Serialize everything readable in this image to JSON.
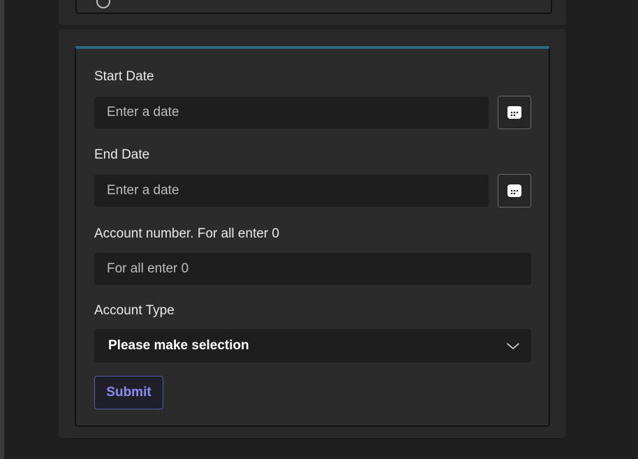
{
  "form": {
    "start_date": {
      "label": "Start Date",
      "placeholder": "Enter a date",
      "value": ""
    },
    "end_date": {
      "label": "End Date",
      "placeholder": "Enter a date",
      "value": ""
    },
    "account_number": {
      "label": "Account number. For all enter 0",
      "placeholder": "For all enter 0",
      "value": ""
    },
    "account_type": {
      "label": "Account Type",
      "selected": "Please make selection"
    },
    "submit_label": "Submit"
  },
  "icons": {
    "calendar": "calendar-icon",
    "chevron": "chevron-down-icon",
    "radio": "radio-icon"
  },
  "colors": {
    "accent_bar": "#296a80",
    "submit_text": "#8c8cf0",
    "submit_border": "#5a5aa8"
  }
}
